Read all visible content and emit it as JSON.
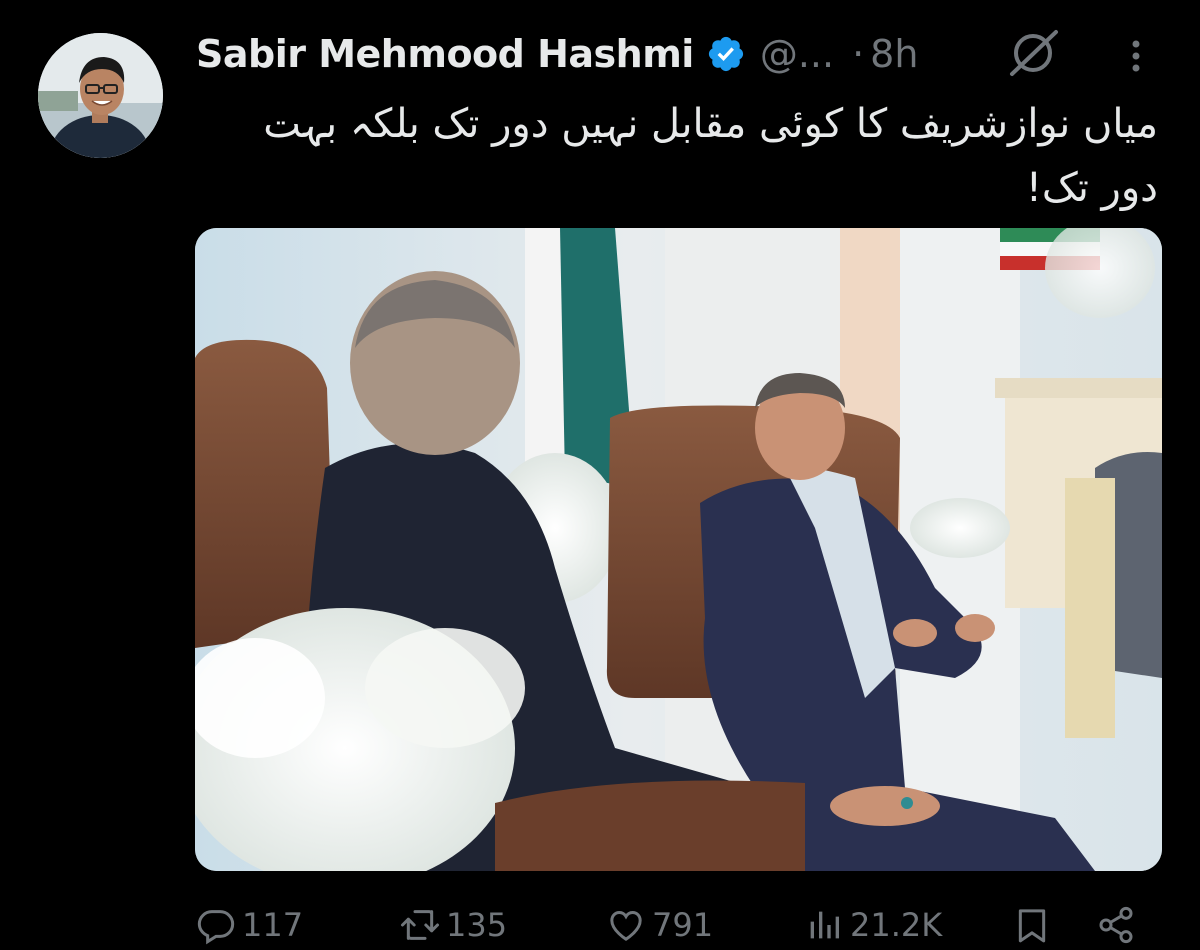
{
  "tweet": {
    "author_name": "Sabir Mehmood Hashmi",
    "handle": "@...",
    "separator": "·",
    "time": "8h",
    "text": "میاں نوازشریف کا کوئی مقابل نہیں دور تک بلکہ بہت دور تک!",
    "icons": {
      "avatar": "avatar",
      "verified": "verified-badge-icon",
      "grok": "grok-icon",
      "more": "more-vertical-icon"
    },
    "colors": {
      "background": "#000000",
      "text": "#e7e9ea",
      "secondary": "#71767b",
      "verified": "#1d9bf0"
    }
  },
  "actions": {
    "reply": {
      "icon": "reply-icon",
      "count": "117"
    },
    "retweet": {
      "icon": "retweet-icon",
      "count": "135"
    },
    "like": {
      "icon": "like-icon",
      "count": "791"
    },
    "views": {
      "icon": "views-icon",
      "count": "21.2K"
    },
    "bookmark": {
      "icon": "bookmark-icon"
    },
    "share": {
      "icon": "share-icon"
    }
  }
}
